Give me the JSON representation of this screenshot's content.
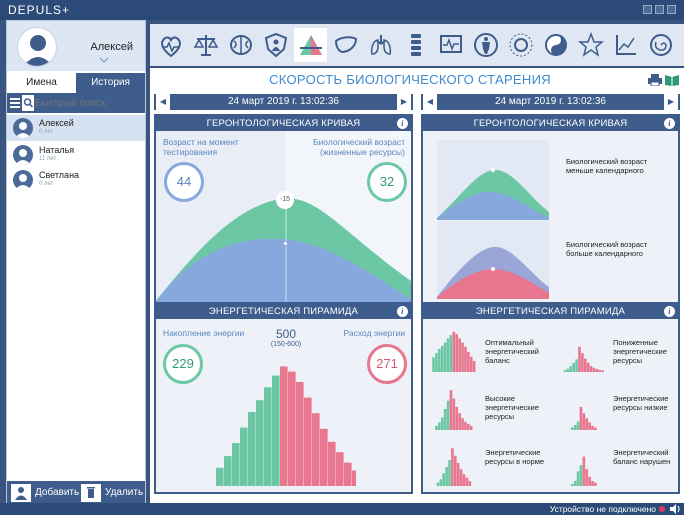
{
  "app": {
    "title": "DEPULS+"
  },
  "profile": {
    "name": "Алексей"
  },
  "sidebar": {
    "tabs": [
      {
        "label": "Имена"
      },
      {
        "label": "История"
      }
    ],
    "search": {
      "placeholder": "Быстрый поиск"
    },
    "users": [
      {
        "name": "Алексей",
        "age": "0 лет",
        "selected": true
      },
      {
        "name": "Наталья",
        "age": "11 лет",
        "selected": false
      },
      {
        "name": "Светлана",
        "age": "0 лет",
        "selected": false
      }
    ],
    "add_label": "Добавить",
    "delete_label": "Удалить"
  },
  "toolbar": {
    "icons": [
      "heart-icon",
      "scales-icon",
      "brain-icon",
      "shield-icon",
      "pyramid-icon",
      "liver-icon",
      "lungs-icon",
      "spine-icon",
      "monitor-icon",
      "body-icon",
      "sun-icon",
      "yin-yang-icon",
      "star-figure-icon",
      "chart-icon",
      "spiral-icon"
    ],
    "active_index": 4
  },
  "main": {
    "title": "СКОРОСТЬ БИОЛОГИЧЕСКОГО СТАРЕНИЯ"
  },
  "left": {
    "date": "24 март 2019 г. 13:02:36",
    "geronto": {
      "title": "ГЕРОНТОЛОГИЧЕСКАЯ КРИВАЯ",
      "age_label": "Возраст на момент тестирования",
      "age_value": "44",
      "bio_label": "Биологический возраст (жизненные ресурсы)",
      "bio_value": "32",
      "diff": "-15"
    },
    "energy": {
      "title": "ЭНЕРГЕТИЧЕСКАЯ ПИРАМИДА",
      "acc_label": "Накопление энергии",
      "acc_value": "229",
      "total": "500",
      "range": "(150-600)",
      "spend_label": "Расход энергии",
      "spend_value": "271",
      "green_bars": [
        0.14,
        0.23,
        0.33,
        0.45,
        0.57,
        0.66,
        0.76,
        0.85
      ],
      "red_bars": [
        0.92,
        0.88,
        0.8,
        0.68,
        0.56,
        0.44,
        0.34,
        0.26,
        0.18,
        0.12
      ]
    }
  },
  "right": {
    "date": "24 март 2019 г. 13:02:36",
    "geronto": {
      "title": "ГЕРОНТОЛОГИЧЕСКАЯ КРИВАЯ",
      "items": [
        {
          "text": "Биологический возраст меньше календарного"
        },
        {
          "text": "Биологический возраст больше календарного"
        }
      ]
    },
    "energy": {
      "title": "ЭНЕРГЕТИЧЕСКАЯ ПИРАМИДА",
      "items": [
        {
          "text": "Оптимальный энергетический баланс"
        },
        {
          "text": "Пониженные энергетические ресурсы"
        },
        {
          "text": "Высокие энергетические ресурсы"
        },
        {
          "text": "Энергетические ресурсы низкие"
        },
        {
          "text": "Энергетические ресурсы в норме"
        },
        {
          "text": "Энергетический баланс нарушен"
        }
      ]
    }
  },
  "status": {
    "text": "Устройство не подключено"
  },
  "colors": {
    "green": "#6cc8a4",
    "red": "#e8768e",
    "blue": "#86a8dc",
    "navy": "#3e5c8c",
    "accent": "#3e8ad0"
  }
}
